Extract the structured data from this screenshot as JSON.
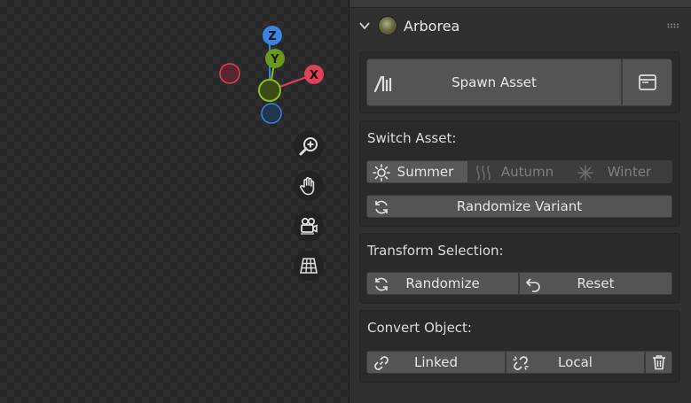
{
  "gizmo": {
    "axes": [
      "Z",
      "Y",
      "X"
    ]
  },
  "viewport_nav": {
    "tools": [
      "zoom-icon",
      "hand-pan-icon",
      "camera-icon",
      "grid-ortho-icon"
    ]
  },
  "panel": {
    "title": "Arborea",
    "spawn": {
      "label": "Spawn Asset"
    },
    "switch_asset": {
      "heading": "Switch Asset:",
      "seasons": [
        "Summer",
        "Autumn",
        "Winter"
      ],
      "selected": "Summer",
      "randomize_label": "Randomize Variant"
    },
    "transform": {
      "heading": "Transform Selection:",
      "randomize_label": "Randomize",
      "reset_label": "Reset"
    },
    "convert": {
      "heading": "Convert Object:",
      "linked_label": "Linked",
      "local_label": "Local"
    }
  },
  "colors": {
    "x_axis": "#e0405a",
    "y_axis": "#8bbf20",
    "z_axis": "#3a83e0",
    "panel_bg": "#303030",
    "button": "#545454"
  }
}
